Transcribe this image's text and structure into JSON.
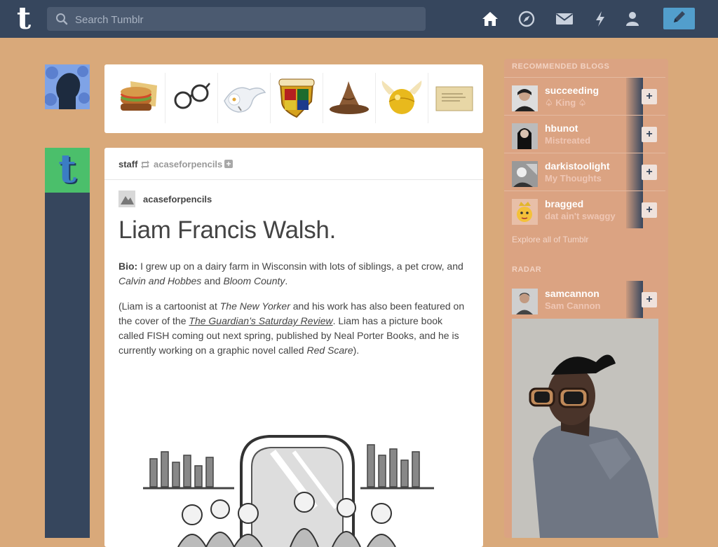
{
  "header": {
    "logo": "t",
    "search_placeholder": "Search Tumblr",
    "nav_icons": [
      "home-icon",
      "compass-icon",
      "mail-icon",
      "lightning-icon",
      "account-icon"
    ],
    "compose_icon": "pencil-icon"
  },
  "icons_post": {
    "items": [
      "sandwich-icon",
      "glasses-icon",
      "owl-icon",
      "hogwarts-crest-icon",
      "sorting-hat-icon",
      "golden-snitch-icon",
      "letter-icon"
    ]
  },
  "post": {
    "author": "staff",
    "reblogged_from": "acaseforpencils",
    "source_name": "acaseforpencils",
    "title": "Liam Francis Walsh.",
    "p1": {
      "bio_label": "Bio:",
      "text1": " I grew up on a dairy farm in Wisconsin with lots of siblings, a pet crow, and ",
      "em1": "Calvin and Hobbes",
      "text2": " and ",
      "em2": "Bloom County",
      "text3": "."
    },
    "p2": {
      "text1": "(Liam is a cartoonist at ",
      "em1": "The New Yorker",
      "text2": " and his work has also been featured on the cover of the ",
      "link": "The Guardian’s Saturday Review",
      "text3": ". Liam has a picture book called FISH coming out next spring, published by Neal Porter Books, and he is currently working on a graphic novel called ",
      "em2": "Red Scare",
      "text4": ")."
    }
  },
  "sidebar": {
    "recommended_title": "RECOMMENDED BLOGS",
    "recommended": [
      {
        "name": "succeeding",
        "subtitle": "♤ King ♤"
      },
      {
        "name": "hbunot",
        "subtitle": "Mistreated"
      },
      {
        "name": "darkistoolight",
        "subtitle": "My Thoughts"
      },
      {
        "name": "bragged",
        "subtitle": "dat ain't swaggy"
      }
    ],
    "explore": "Explore all of Tumblr",
    "radar_title": "RADAR",
    "radar": {
      "name": "samcannon",
      "subtitle": "Sam Cannon"
    },
    "colors": {
      "nav": "#36465d",
      "compose": "#529ecc",
      "background": "#d9a97a"
    }
  }
}
